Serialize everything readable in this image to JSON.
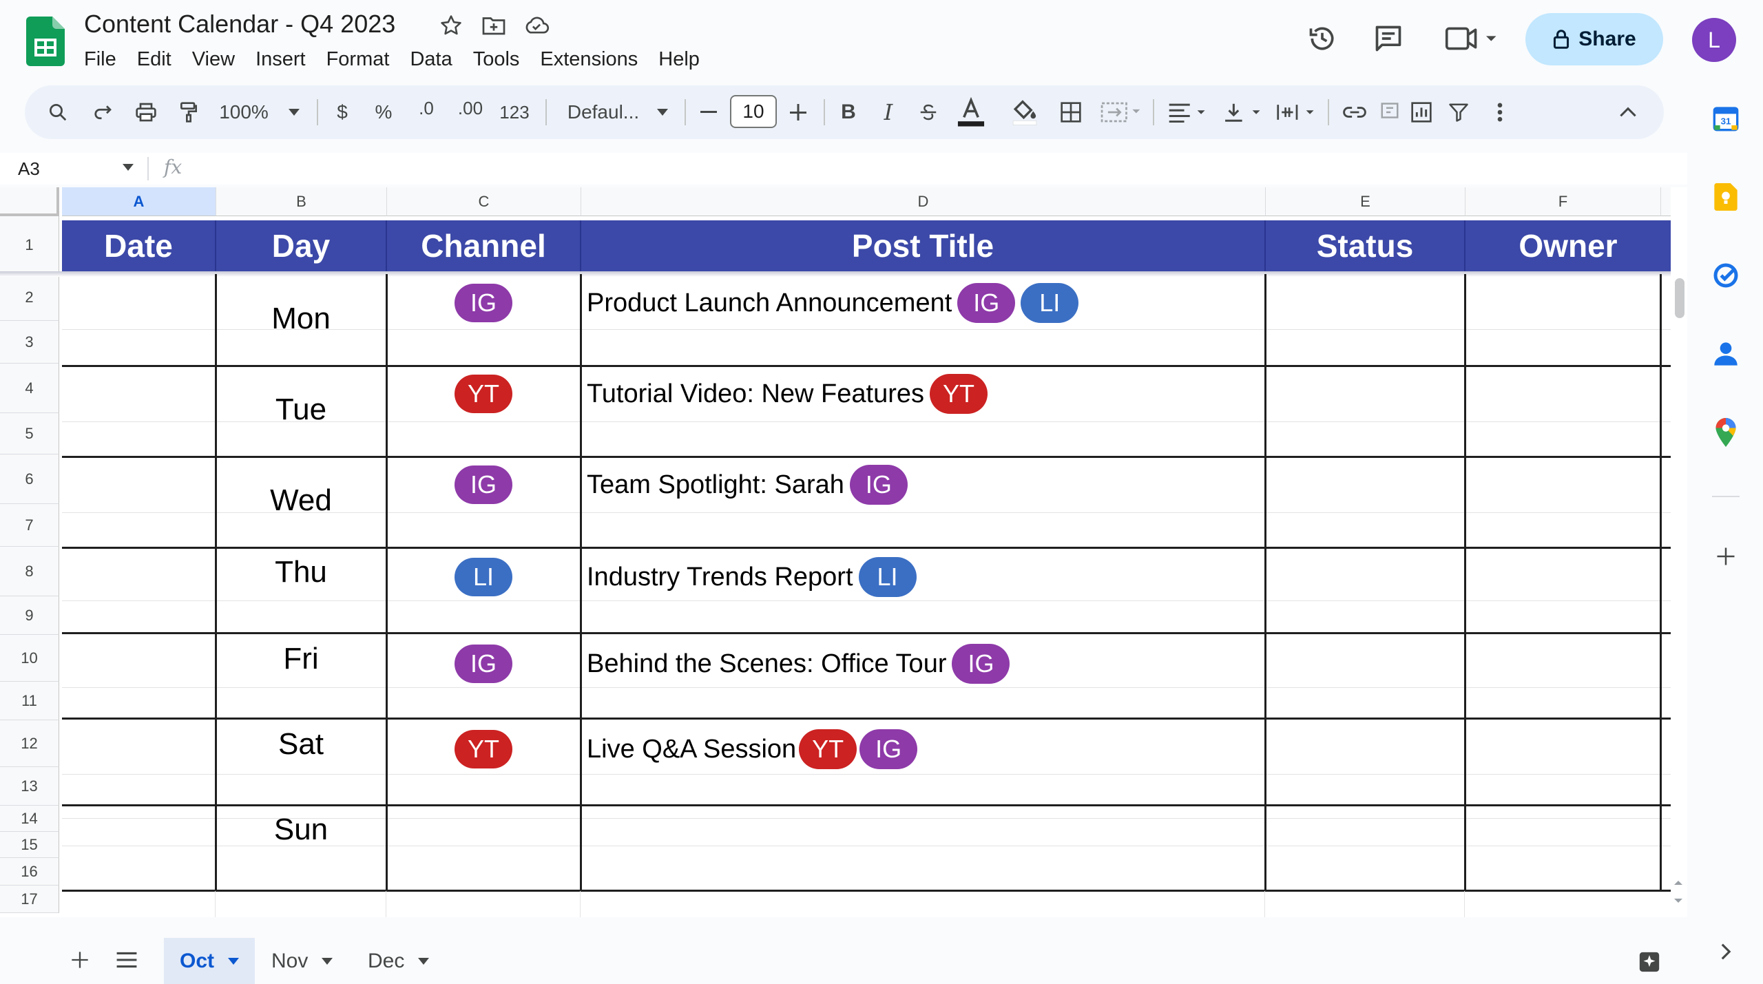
{
  "app": {
    "title": "Content Calendar - Q4 2023",
    "menus": [
      "File",
      "Edit",
      "View",
      "Insert",
      "Format",
      "Data",
      "Tools",
      "Extensions",
      "Help"
    ],
    "share_label": "Share",
    "avatar_letter": "L"
  },
  "toolbar": {
    "zoom": "100%",
    "currency": "$",
    "percent": "%",
    "decrease_decimal": ".0",
    "increase_decimal": ".00",
    "number_format": "123",
    "font": "Defaul...",
    "font_size": "10"
  },
  "formula_bar": {
    "cell_ref": "A3",
    "fx": "fx"
  },
  "grid": {
    "columns": [
      "A",
      "B",
      "C",
      "D",
      "E",
      "F"
    ],
    "rows": [
      "1",
      "2",
      "3",
      "4",
      "5",
      "6",
      "7",
      "8",
      "9",
      "10",
      "11",
      "12",
      "13",
      "14",
      "15",
      "16",
      "17"
    ],
    "headers": [
      "Date",
      "Day",
      "Channel",
      "Post Title",
      "Status",
      "Owner"
    ],
    "entries": [
      {
        "day": "Mon",
        "channel": "IG",
        "title": "Product Launch Announcement",
        "tags": [
          "IG",
          "LI"
        ]
      },
      {
        "day": "Tue",
        "channel": "YT",
        "title": "Tutorial Video: New Features",
        "tags": [
          "YT"
        ]
      },
      {
        "day": "Wed",
        "channel": "IG",
        "title": "Team Spotlight: Sarah",
        "tags": [
          "IG"
        ]
      },
      {
        "day": "Thu",
        "channel": "LI",
        "title": "Industry Trends Report",
        "tags": [
          "LI"
        ]
      },
      {
        "day": "Fri",
        "channel": "IG",
        "title": "Behind the Scenes: Office Tour",
        "tags": [
          "IG"
        ]
      },
      {
        "day": "Sat",
        "channel": "YT",
        "title": "Live Q&A Session",
        "tags": [
          "YT",
          "IG"
        ]
      },
      {
        "day": "Sun"
      }
    ]
  },
  "sheets": {
    "tabs": [
      "Oct",
      "Nov",
      "Dec"
    ],
    "active": "Oct"
  },
  "colors": {
    "header_bg": "#3c49a8",
    "ig": "#8e3aa9",
    "li": "#3b6fc4",
    "yt": "#cc2222",
    "share_bg": "#c2e7ff",
    "avatar": "#7b3fbf"
  }
}
